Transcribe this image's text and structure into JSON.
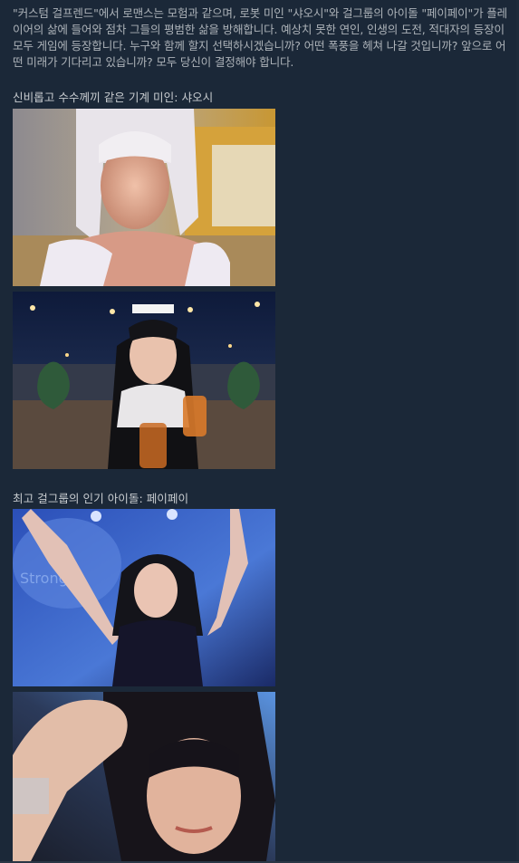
{
  "description": {
    "text": "\"커스텀 걸프렌드\"에서 로맨스는 모험과 같으며, 로봇 미인 \"샤오시\"와 걸그룹의 아이돌 \"페이페이\"가 플레이어의 삶에 들어와 점차 그들의 평범한 삶을 방해합니다. 예상치 못한 연인, 인생의 도전, 적대자의 등장이 모두 게임에 등장합니다. 누구와 함께 할지 선택하시겠습니까? 어떤 폭풍을 헤쳐 나갈 것입니까? 앞으로 어떤 미래가 기다리고 있습니까? 모두 당신이 결정해야 합니다."
  },
  "sections": [
    {
      "title": "신비롭고 수수께끼 같은 기계 미인: 샤오시"
    },
    {
      "title": "최고 걸그룹의 인기 아이돌: 페이페이"
    }
  ],
  "colors": {
    "background": "#1b2838",
    "text": "#acb2b8"
  }
}
